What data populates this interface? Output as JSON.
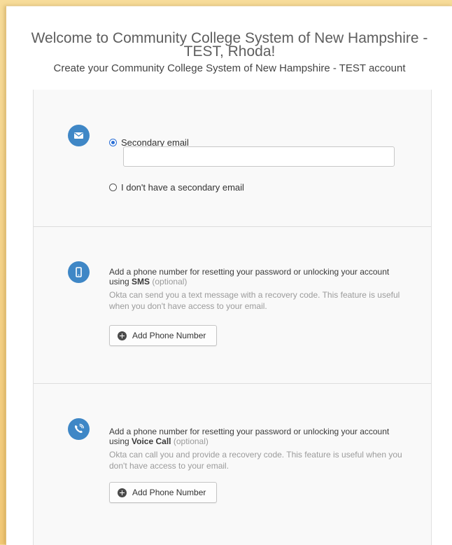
{
  "header": {
    "title": "Welcome to Community College System of New Hampshire - TEST, Rhoda!",
    "subtitle": "Create your Community College System of New Hampshire - TEST account"
  },
  "email_section": {
    "icon": "envelope-icon",
    "option_secondary": "Secondary email",
    "email_value": "",
    "option_none": "I don't have a secondary email",
    "selected": "secondary"
  },
  "sms_section": {
    "icon": "mobile-phone-icon",
    "title_prefix": "Add a phone number for resetting your password or unlocking your account using ",
    "title_method": "SMS",
    "optional": "(optional)",
    "description": "Okta can send you a text message with a recovery code. This feature is useful when you don't have access to your email.",
    "button_label": "Add Phone Number"
  },
  "voice_section": {
    "icon": "voice-call-icon",
    "title_prefix": "Add a phone number for resetting your password or unlocking your account using ",
    "title_method": "Voice Call",
    "optional": "(optional)",
    "description": "Okta can call you and provide a recovery code. This feature is useful when you don't have access to your email.",
    "button_label": "Add Phone Number"
  },
  "colors": {
    "accent": "#3f87c6",
    "background_outer": "#f2c977"
  }
}
